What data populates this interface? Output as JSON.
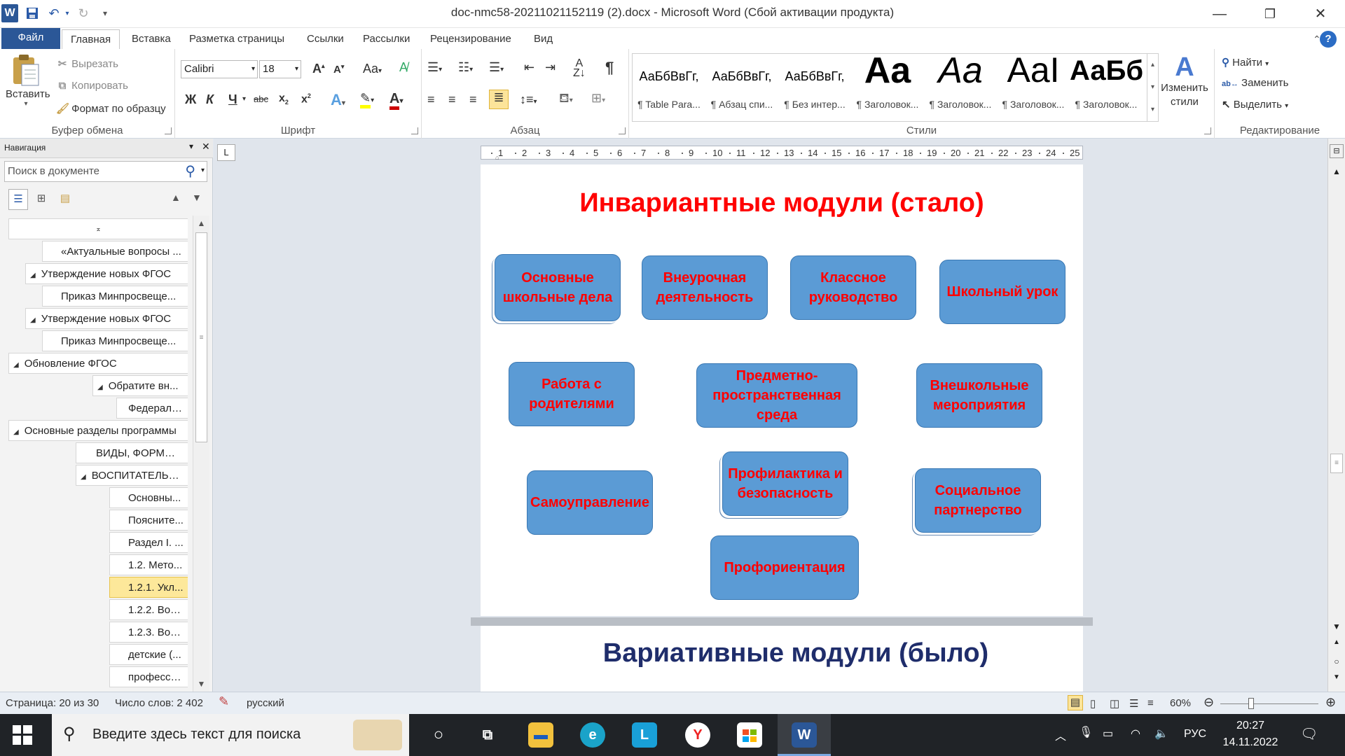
{
  "window": {
    "title": "doc-nmc58-20211021152119 (2).docx - Microsoft Word (Сбой активации продукта)",
    "app_icon": "W"
  },
  "tabs": [
    {
      "label": "Файл"
    },
    {
      "label": "Главная"
    },
    {
      "label": "Вставка"
    },
    {
      "label": "Разметка страницы"
    },
    {
      "label": "Ссылки"
    },
    {
      "label": "Рассылки"
    },
    {
      "label": "Рецензирование"
    },
    {
      "label": "Вид"
    }
  ],
  "ribbon": {
    "clipboard": {
      "paste": "Вставить",
      "cut": "Вырезать",
      "copy": "Копировать",
      "format_painter": "Формат по образцу",
      "group_label": "Буфер обмена"
    },
    "font": {
      "font_name": "Calibri",
      "font_size": "18",
      "group_label": "Шрифт"
    },
    "paragraph": {
      "group_label": "Абзац"
    },
    "styles": {
      "group_label": "Стили",
      "items": [
        {
          "sample": "АаБбВвГг,",
          "name": "¶ Table Para..."
        },
        {
          "sample": "АаБбВвГг,",
          "name": "¶ Абзац спи..."
        },
        {
          "sample": "АаБбВвГг,",
          "name": "¶ Без интер..."
        },
        {
          "sample": "Aa",
          "name": "¶ Заголовок..."
        },
        {
          "sample": "Aa",
          "name": "¶ Заголовок..."
        },
        {
          "sample": "AaI",
          "name": "¶ Заголовок..."
        },
        {
          "sample": "АаБб",
          "name": "¶ Заголовок..."
        }
      ],
      "change_styles": "Изменить стили"
    },
    "editing": {
      "find": "Найти",
      "replace": "Заменить",
      "select": "Выделить",
      "group_label": "Редактирование"
    }
  },
  "navigation": {
    "title": "Навигация",
    "search_placeholder": "Поиск в документе",
    "items": [
      {
        "label": "«Актуальные вопросы ...",
        "expanded": false,
        "selected": false
      },
      {
        "label": "Утверждение новых ФГОС",
        "expanded": true,
        "selected": false
      },
      {
        "label": "Приказ Минпросвеще...",
        "expanded": false,
        "selected": false
      },
      {
        "label": "Утверждение новых ФГОС",
        "expanded": true,
        "selected": false
      },
      {
        "label": "Приказ Минпросвеще...",
        "expanded": false,
        "selected": false
      },
      {
        "label": "Обновление ФГОС",
        "expanded": true,
        "selected": false
      },
      {
        "label": "Обратите вн...",
        "expanded": true,
        "selected": false
      },
      {
        "label": "Федераль...",
        "expanded": false,
        "selected": false
      },
      {
        "label": "Основные разделы программы",
        "expanded": true,
        "selected": false
      },
      {
        "label": "ВИДЫ, ФОРМЫ ...",
        "expanded": false,
        "selected": false
      },
      {
        "label": "ВОСПИТАТЕЛЬН...",
        "expanded": true,
        "selected": false
      },
      {
        "label": "Основны...",
        "expanded": false,
        "selected": false
      },
      {
        "label": "Поясните...",
        "expanded": false,
        "selected": false
      },
      {
        "label": "Раздел I. ...",
        "expanded": false,
        "selected": false
      },
      {
        "label": "1.2. Мето...",
        "expanded": false,
        "selected": false
      },
      {
        "label": "1.2.1. Укл...",
        "expanded": false,
        "selected": true
      },
      {
        "label": "1.2.2. Вос...",
        "expanded": false,
        "selected": false
      },
      {
        "label": "1.2.3. Вос...",
        "expanded": false,
        "selected": false
      },
      {
        "label": "детские (...",
        "expanded": false,
        "selected": false
      },
      {
        "label": "професси...",
        "expanded": false,
        "selected": false
      }
    ]
  },
  "ruler": {
    "ticks": [
      "1",
      "2",
      "3",
      "4",
      "5",
      "6",
      "7",
      "8",
      "9",
      "10",
      "11",
      "12",
      "13",
      "14",
      "15",
      "16",
      "17",
      "18",
      "19",
      "20",
      "21",
      "22",
      "23",
      "24",
      "25"
    ]
  },
  "document": {
    "page1": {
      "title": "Инвариантные модули (стало)",
      "modules": [
        "Основные школьные дела",
        "Внеурочная деятельность",
        "Классное руководство",
        "Школьный урок",
        "Работа с родителями",
        "Предметно-пространственная среда",
        "Внешкольные мероприятия",
        "Самоуправление",
        "Профилактика и безопасность",
        "Социальное партнерство",
        "Профориентация"
      ]
    },
    "page2": {
      "title": "Вариативные модули (было)"
    }
  },
  "status": {
    "page": "Страница: 20 из 30",
    "words": "Число слов: 2 402",
    "language": "русский",
    "zoom": "60%"
  },
  "taskbar": {
    "search_placeholder": "Введите здесь текст для поиска",
    "lang": "РУС",
    "time": "20:27",
    "date": "14.11.2022"
  },
  "colors": {
    "accent": "#2b5797",
    "module_fill": "#5b9bd5",
    "module_text": "#ff0000",
    "title_red": "#ff0000",
    "title2": "#1f2d6b"
  }
}
